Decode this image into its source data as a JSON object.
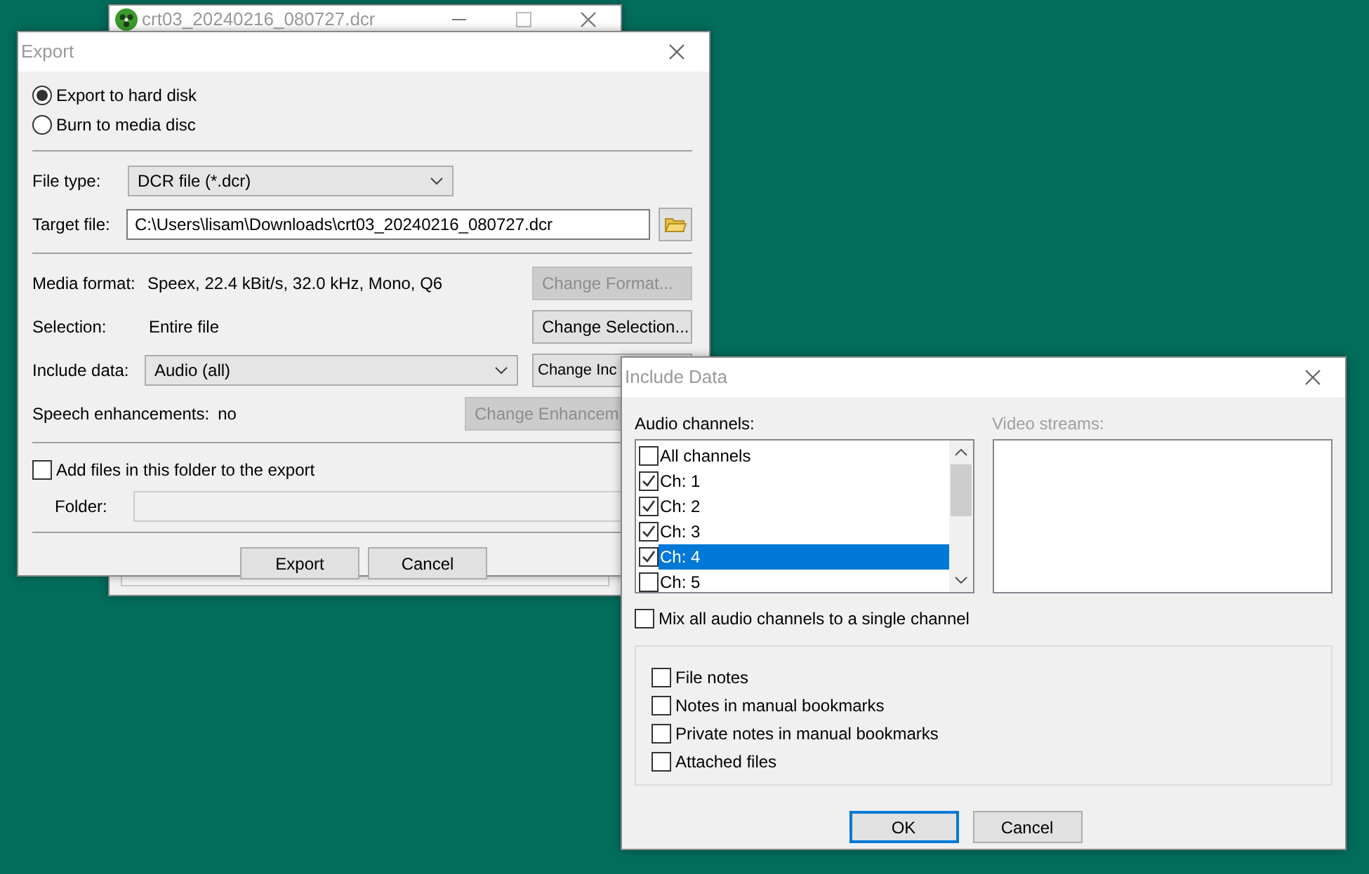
{
  "background_window": {
    "title": "crt03_20240216_080727.dcr"
  },
  "export_dialog": {
    "title": "Export",
    "destinations": [
      {
        "label": "Export to hard disk",
        "selected": true
      },
      {
        "label": "Burn to media disc",
        "selected": false
      }
    ],
    "file_type": {
      "label": "File type:",
      "value": "DCR file (*.dcr)"
    },
    "target_file": {
      "label": "Target file:",
      "value": "C:\\Users\\lisam\\Downloads\\crt03_20240216_080727.dcr"
    },
    "settings": [
      {
        "kind": "text",
        "label": "Media format:",
        "value": "Speex, 22.4 kBit/s, 32.0 kHz, Mono, Q6",
        "button": "Change Format...",
        "disabled": true
      },
      {
        "kind": "text",
        "label": "Selection:",
        "value": "Entire file",
        "button": "Change Selection...",
        "disabled": false
      },
      {
        "kind": "select",
        "label": "Include data:",
        "value": "Audio (all)",
        "button": "Change Inc",
        "disabled": false
      },
      {
        "kind": "text",
        "label": "Speech enhancements:",
        "value": "no",
        "button": "Change Enhancem",
        "disabled": true
      }
    ],
    "add_files": {
      "label": "Add files in this folder to the export",
      "checked": false
    },
    "folder": {
      "label": "Folder:"
    },
    "buttons": [
      {
        "label": "Export"
      },
      {
        "label": "Cancel"
      }
    ]
  },
  "include_dialog": {
    "title": "Include Data",
    "audio_label": "Audio channels:",
    "channels": [
      {
        "label": "All channels",
        "checked": false,
        "selected": false
      },
      {
        "label": "Ch: 1",
        "checked": true,
        "selected": false
      },
      {
        "label": "Ch: 2",
        "checked": true,
        "selected": false
      },
      {
        "label": "Ch: 3",
        "checked": true,
        "selected": false
      },
      {
        "label": "Ch: 4",
        "checked": true,
        "selected": true
      },
      {
        "label": "Ch: 5",
        "checked": false,
        "selected": false
      }
    ],
    "video_label": "Video streams:",
    "video_disabled": true,
    "mix": {
      "label": "Mix all audio channels to a single channel",
      "checked": false
    },
    "options": [
      {
        "label": "File notes",
        "checked": false
      },
      {
        "label": "Notes in manual bookmarks",
        "checked": false
      },
      {
        "label": "Private notes in manual bookmarks",
        "checked": false
      },
      {
        "label": "Attached files",
        "checked": false
      }
    ],
    "buttons": [
      {
        "label": "OK",
        "default": true
      },
      {
        "label": "Cancel",
        "default": false
      }
    ]
  }
}
